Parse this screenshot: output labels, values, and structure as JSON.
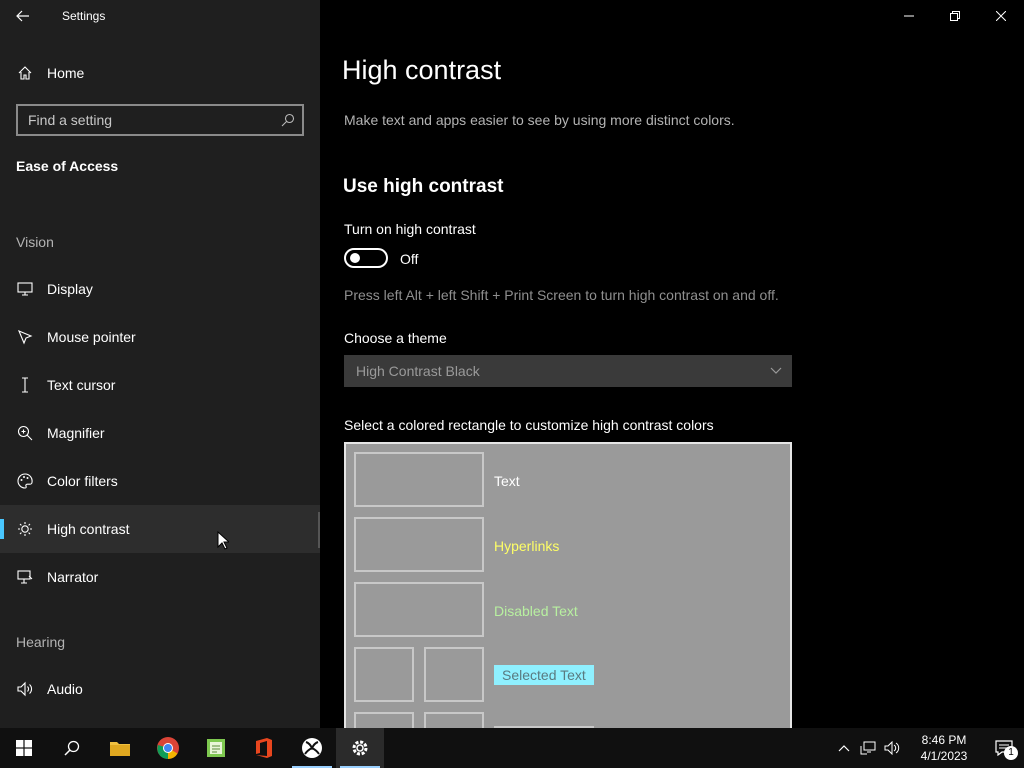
{
  "app": {
    "title": "Settings"
  },
  "sidebar": {
    "home_label": "Home",
    "search_placeholder": "Find a setting",
    "section_title": "Ease of Access",
    "groups": {
      "vision": "Vision",
      "hearing": "Hearing"
    },
    "items": [
      {
        "label": "Display",
        "icon": "monitor-icon"
      },
      {
        "label": "Mouse pointer",
        "icon": "pointer-icon"
      },
      {
        "label": "Text cursor",
        "icon": "text-cursor-icon"
      },
      {
        "label": "Magnifier",
        "icon": "magnifier-icon"
      },
      {
        "label": "Color filters",
        "icon": "palette-icon"
      },
      {
        "label": "High contrast",
        "icon": "brightness-icon",
        "selected": true
      },
      {
        "label": "Narrator",
        "icon": "narrator-icon"
      },
      {
        "label": "Audio",
        "icon": "speaker-icon"
      }
    ]
  },
  "main": {
    "title": "High contrast",
    "description": "Make text and apps easier to see by using more distinct colors.",
    "section_heading": "Use high contrast",
    "toggle_label": "Turn on high contrast",
    "toggle_state": "Off",
    "shortcut_hint": "Press left Alt + left Shift + Print Screen to turn high contrast on and off.",
    "theme_label": "Choose a theme",
    "theme_value": "High Contrast Black",
    "colors_label": "Select a colored rectangle to customize high contrast colors",
    "swatches": [
      {
        "label": "Text",
        "color": "#ffffff"
      },
      {
        "label": "Hyperlinks",
        "color": "#ffff66"
      },
      {
        "label": "Disabled Text",
        "color": "#b8f0a0"
      },
      {
        "label": "Selected Text",
        "color": "#8ff0ff"
      }
    ]
  },
  "taskbar": {
    "time": "8:46 PM",
    "date": "4/1/2023",
    "notification_count": "1",
    "apps": [
      "start-icon",
      "search-icon",
      "file-explorer-icon",
      "chrome-icon",
      "notepad-icon",
      "office-icon",
      "xbox-icon",
      "settings-icon"
    ]
  },
  "colors": {
    "accent": "#49c7ff",
    "sidebar_bg": "#1f1f1f",
    "main_bg": "#000000",
    "preview_bg": "#9a9a9a"
  }
}
